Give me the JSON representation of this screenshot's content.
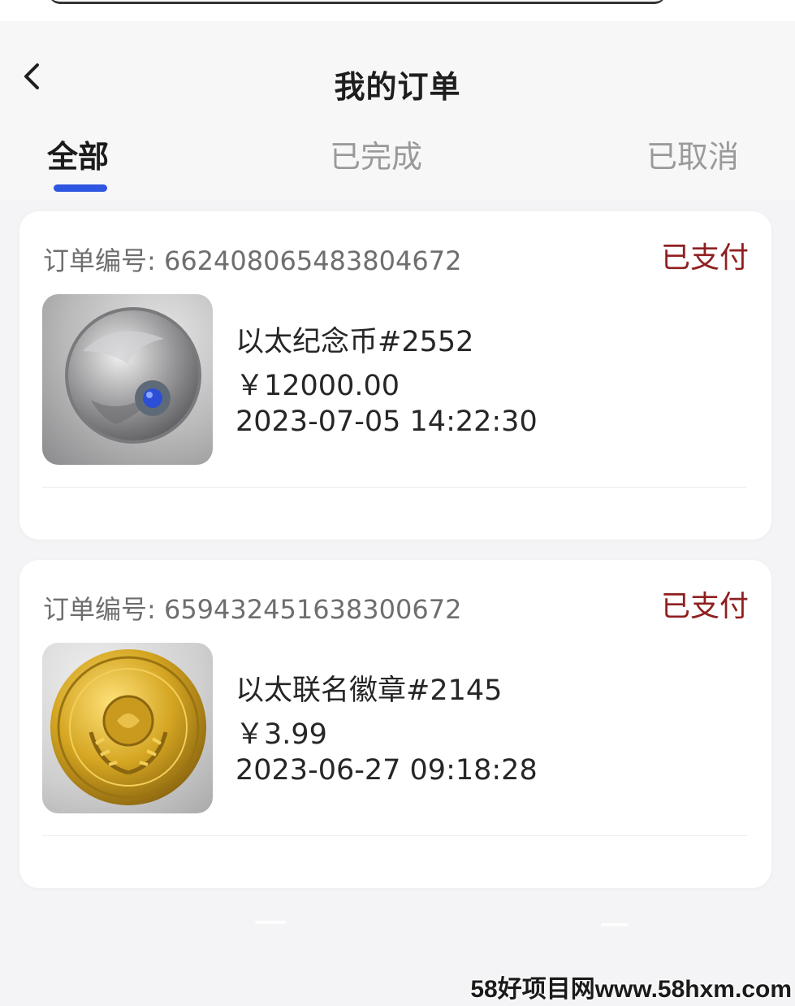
{
  "header": {
    "title": "我的订单",
    "tabs": [
      {
        "label": "全部",
        "active": true
      },
      {
        "label": "已完成",
        "active": false
      },
      {
        "label": "已取消",
        "active": false
      }
    ],
    "accent_color": "#2f56e0"
  },
  "orders": [
    {
      "order_no_label": "订单编号: 6624080654838046​72",
      "status": "已支付",
      "name": "以太纪念币#2552",
      "price": "￥12000.00",
      "time": "2023-07-05 14:22:30",
      "thumb_icon": "silver-coin-icon"
    },
    {
      "order_no_label": "订单编号: 659432451638300672",
      "status": "已支付",
      "name": "以太联名徽章#2145",
      "price": "￥3.99",
      "time": "2023-06-27 09:18:28",
      "thumb_icon": "gold-badge-icon"
    }
  ],
  "status_color": "#8f1f1f",
  "watermark": "58好项目网www.58hxm.com"
}
